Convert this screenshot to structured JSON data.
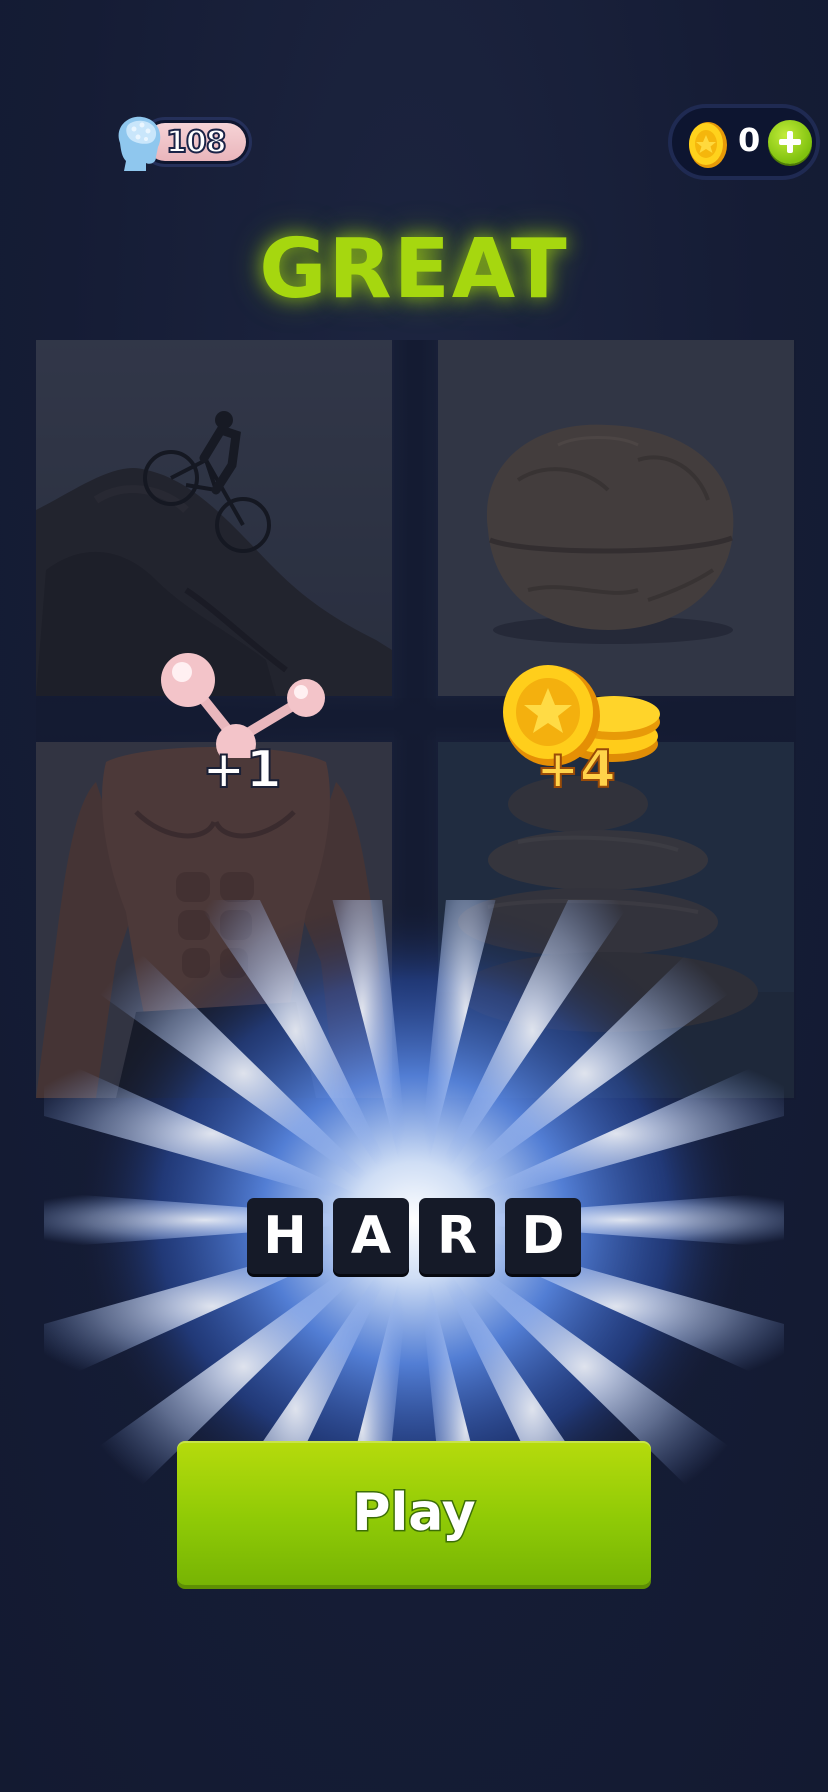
{
  "header": {
    "brain_count": "108",
    "coin_count": "0",
    "brain_icon": "brain-head-icon",
    "coin_icon": "gold-coin-icon",
    "add_icon": "plus-icon"
  },
  "result": {
    "title": "GREAT",
    "title_color": "#a6d70f"
  },
  "pictures": [
    {
      "name": "cyclist-on-rock",
      "subject": "mountain bike jump"
    },
    {
      "name": "walnut",
      "subject": "nut shell"
    },
    {
      "name": "muscular-torso",
      "subject": "abs"
    },
    {
      "name": "stacked-stones",
      "subject": "rocks"
    }
  ],
  "rewards": {
    "brain_reward": "+1",
    "coin_reward": "+4"
  },
  "answer": {
    "letters": [
      "H",
      "A",
      "R",
      "D"
    ]
  },
  "actions": {
    "play_label": "Play",
    "play_color": "#8fca06"
  }
}
